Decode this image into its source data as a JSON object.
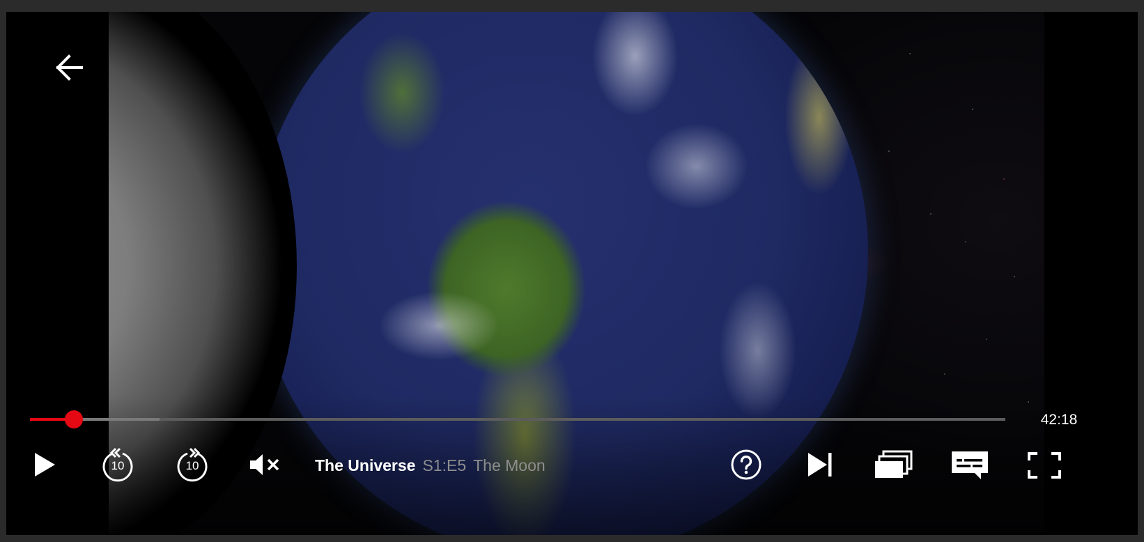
{
  "player": {
    "show_title": "The Universe",
    "episode_code": "S1:E5",
    "episode_title": "The Moon",
    "time_remaining": "42:18",
    "progress_played": 0.045,
    "progress_buffered": 0.133,
    "accent_color": "#e50914",
    "muted": true
  },
  "icons": {
    "back": "arrow-left-icon",
    "play": "play-icon",
    "rewind": "rewind-10-icon",
    "forward": "forward-10-icon",
    "volume": "volume-muted-icon",
    "help": "help-icon",
    "next": "next-episode-icon",
    "episodes": "episodes-icon",
    "subtitles": "subtitles-icon",
    "fullscreen": "fullscreen-icon"
  },
  "skip_seconds": "10"
}
